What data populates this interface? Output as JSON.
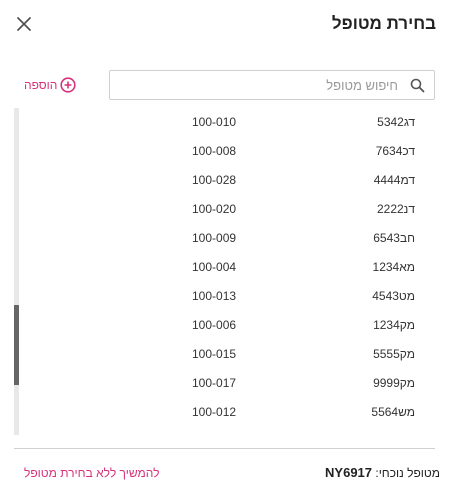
{
  "header": {
    "title": "בחירת מטופל"
  },
  "add_button": {
    "label": "הוספה"
  },
  "search": {
    "placeholder": "חיפוש מטופל",
    "value": ""
  },
  "patients": [
    {
      "name": "דג5342",
      "code": "100-010"
    },
    {
      "name": "דכ7634",
      "code": "100-008"
    },
    {
      "name": "דמ4444",
      "code": "100-028"
    },
    {
      "name": "דנ2222",
      "code": "100-020"
    },
    {
      "name": "חב6543",
      "code": "100-009"
    },
    {
      "name": "מא1234",
      "code": "100-004"
    },
    {
      "name": "מט4543",
      "code": "100-013"
    },
    {
      "name": "מק1234",
      "code": "100-006"
    },
    {
      "name": "מק5555",
      "code": "100-015"
    },
    {
      "name": "מק9999",
      "code": "100-017"
    },
    {
      "name": "מש5564",
      "code": "100-012"
    }
  ],
  "footer": {
    "current_label": "מטופל נוכחי:",
    "current_code": "NY6917",
    "continue_label": "להמשיך ללא בחירת מטופל"
  },
  "colors": {
    "accent": "#d6337a",
    "scroll_thumb": "#666666"
  }
}
